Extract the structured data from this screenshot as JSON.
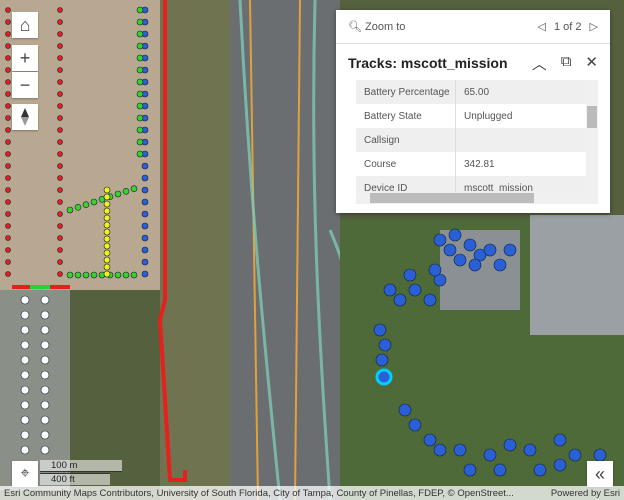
{
  "map": {
    "controls": {
      "home": "home-icon",
      "zoom_in": "+",
      "zoom_out": "−",
      "compass": "compass-icon",
      "locate": "locate-icon",
      "expand": "«"
    },
    "scale": {
      "metric": "100 m",
      "imperial": "400 ft"
    },
    "attribution": "Esri Community Maps Contributors, University of South Florida, City of Tampa, County of Pinellas, FDEP, © OpenStreet...",
    "powered_by": "Powered by Esri"
  },
  "popup": {
    "zoom_to": "Zoom to",
    "page": "1 of 2",
    "title": "Tracks: mscott_mission",
    "rows": [
      {
        "key": "Battery Percentage",
        "value": "65.00"
      },
      {
        "key": "Battery State",
        "value": "Unplugged"
      },
      {
        "key": "Callsign",
        "value": ""
      },
      {
        "key": "Course",
        "value": "342.81"
      },
      {
        "key": "Device ID",
        "value": "mscott_mission"
      }
    ]
  },
  "colors": {
    "track_point": "#2a5fd6",
    "route": "#e8201c",
    "highlight": "#00d0ff"
  }
}
